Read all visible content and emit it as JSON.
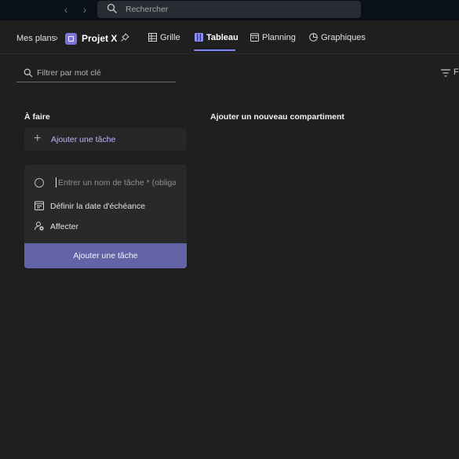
{
  "topbar": {
    "back_icon": "chevron-left-icon",
    "forward_icon": "chevron-right-icon",
    "search_placeholder": "Rechercher"
  },
  "header": {
    "breadcrumb_root": "Mes plans",
    "plan_name": "Projet X",
    "tabs": [
      {
        "label": "Grille",
        "icon": "grid-icon"
      },
      {
        "label": "Tableau",
        "icon": "board-icon",
        "active": true
      },
      {
        "label": "Planning",
        "icon": "calendar-icon"
      },
      {
        "label": "Graphiques",
        "icon": "chart-icon"
      }
    ]
  },
  "filter": {
    "placeholder": "Filtrer par mot clé",
    "right_label": "F"
  },
  "board": {
    "bucket_name": "À faire",
    "add_task_label": "Ajouter une tâche",
    "add_bucket_label": "Ajouter un nouveau compartiment"
  },
  "new_task": {
    "name_placeholder": "Entrer un nom de tâche * (obligatoire)",
    "due_date_label": "Définir la date d'échéance",
    "assign_label": "Affecter",
    "submit_label": "Ajouter une tâche"
  },
  "colors": {
    "accent": "#7f85f5",
    "button": "#6264a7",
    "background": "#1f1f1f"
  }
}
